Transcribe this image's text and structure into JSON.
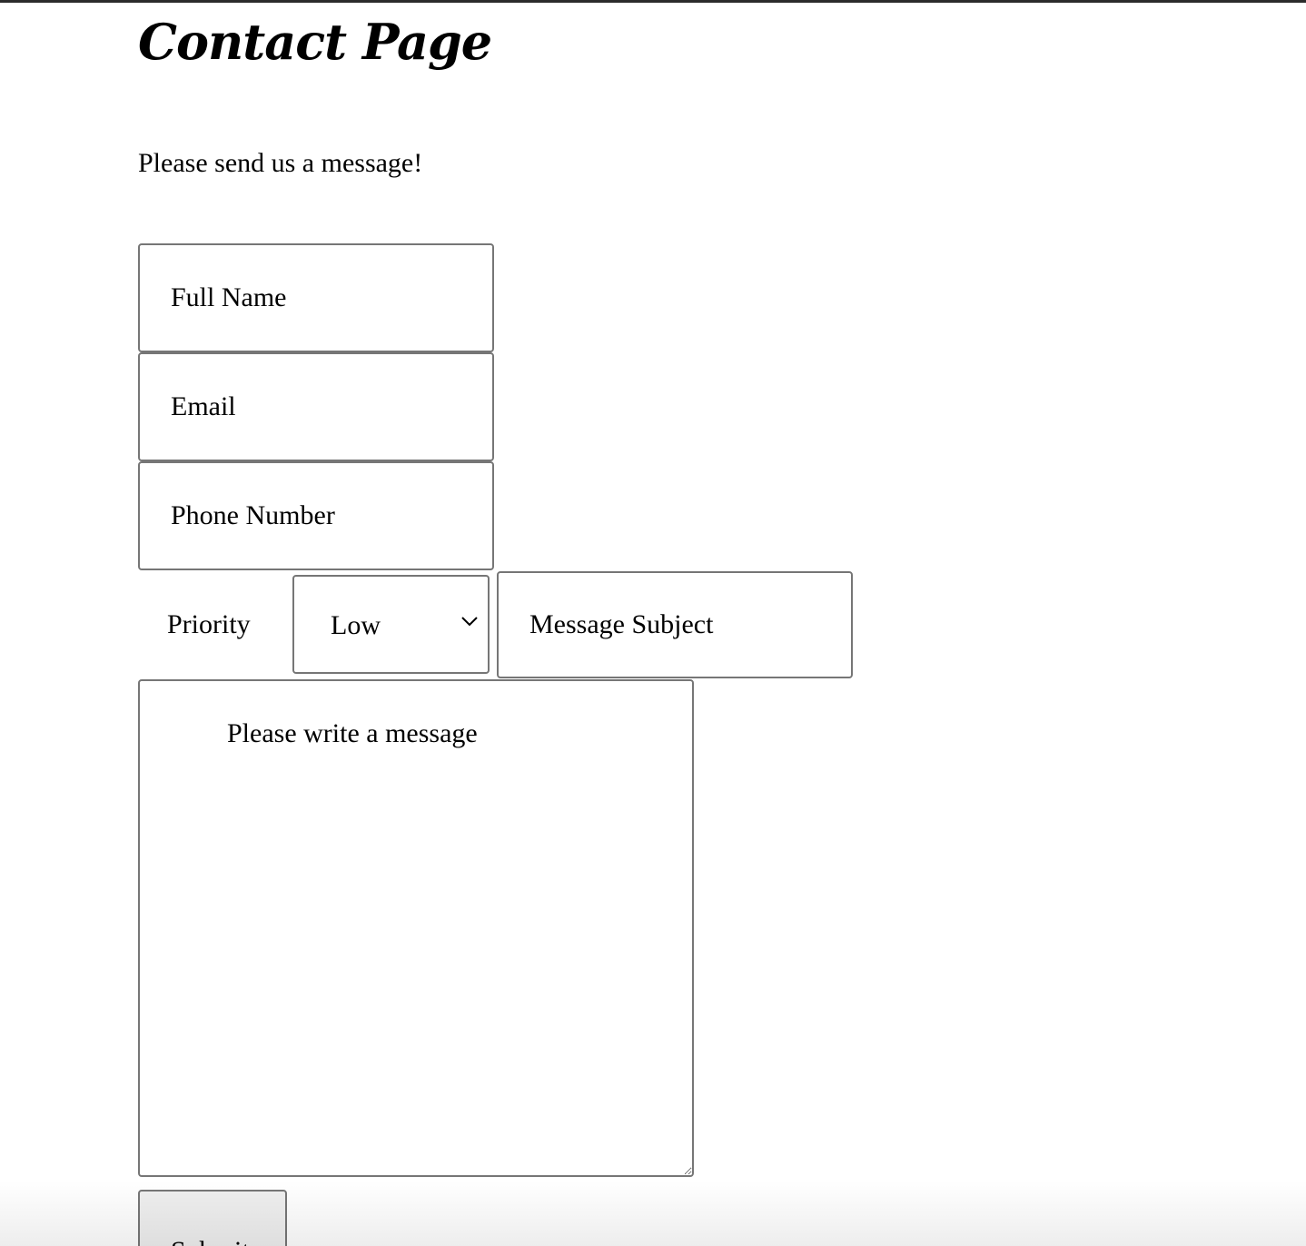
{
  "page": {
    "title": "Contact Page",
    "intro": "Please send us a message!"
  },
  "form": {
    "full_name": {
      "placeholder": "Full Name",
      "value": ""
    },
    "email": {
      "placeholder": "Email",
      "value": ""
    },
    "phone": {
      "placeholder": "Phone Number",
      "value": ""
    },
    "priority": {
      "label": "Priority",
      "selected": "Low"
    },
    "subject": {
      "placeholder": "Message Subject",
      "value": ""
    },
    "message": {
      "placeholder": "Please write a message",
      "value": ""
    },
    "submit_label": "Submit"
  },
  "icons": {
    "select_arrow": "chevron-down-icon",
    "resize_handle": "resize-grip-icon"
  }
}
